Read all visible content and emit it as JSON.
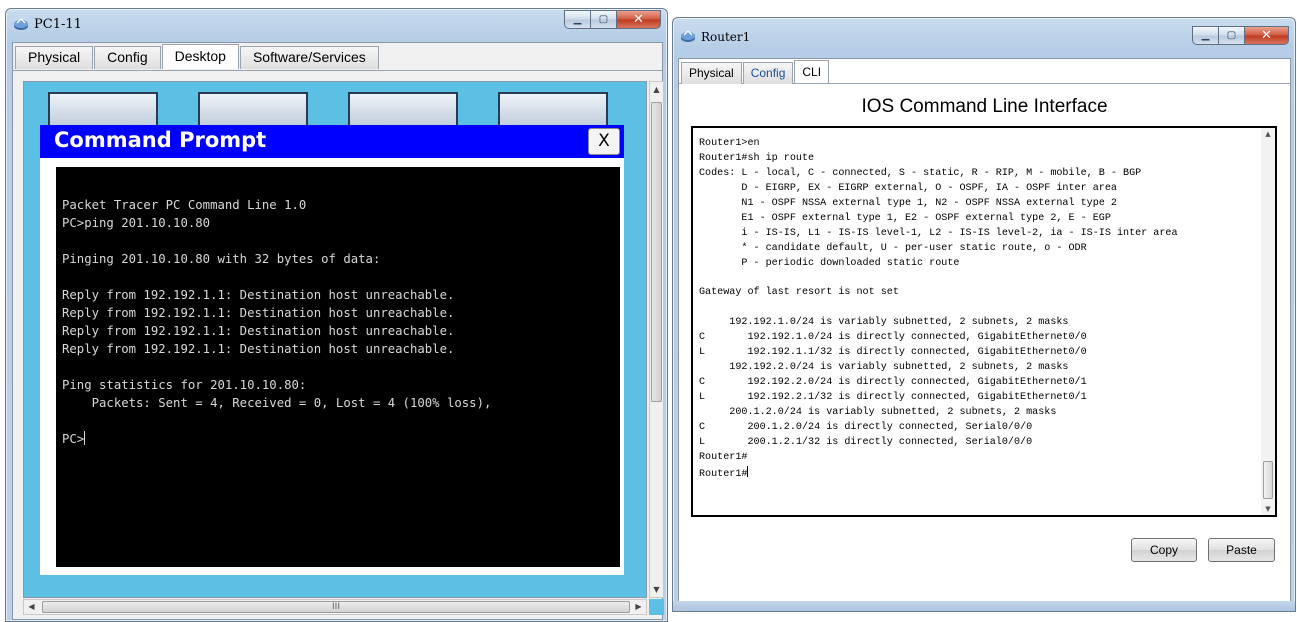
{
  "pc_window": {
    "title": "PC1-11",
    "tabs": [
      "Physical",
      "Config",
      "Desktop",
      "Software/Services"
    ],
    "active_tab": "Desktop",
    "command_prompt": {
      "title": "Command Prompt",
      "close_label": "X",
      "lines": [
        "Packet Tracer PC Command Line 1.0",
        "PC>ping 201.10.10.80",
        "",
        "Pinging 201.10.10.80 with 32 bytes of data:",
        "",
        "Reply from 192.192.1.1: Destination host unreachable.",
        "Reply from 192.192.1.1: Destination host unreachable.",
        "Reply from 192.192.1.1: Destination host unreachable.",
        "Reply from 192.192.1.1: Destination host unreachable.",
        "",
        "Ping statistics for 201.10.10.80:",
        "    Packets: Sent = 4, Received = 0, Lost = 4 (100% loss),",
        "",
        "PC>"
      ]
    },
    "hscroll_grip": "III"
  },
  "router_window": {
    "title": "Router1",
    "tabs": [
      "Physical",
      "Config",
      "CLI"
    ],
    "active_tab": "CLI",
    "heading": "IOS Command Line Interface",
    "cli_lines": [
      "Router1>en",
      "Router1#sh ip route",
      "Codes: L - local, C - connected, S - static, R - RIP, M - mobile, B - BGP",
      "       D - EIGRP, EX - EIGRP external, O - OSPF, IA - OSPF inter area",
      "       N1 - OSPF NSSA external type 1, N2 - OSPF NSSA external type 2",
      "       E1 - OSPF external type 1, E2 - OSPF external type 2, E - EGP",
      "       i - IS-IS, L1 - IS-IS level-1, L2 - IS-IS level-2, ia - IS-IS inter area",
      "       * - candidate default, U - per-user static route, o - ODR",
      "       P - periodic downloaded static route",
      "",
      "Gateway of last resort is not set",
      "",
      "     192.192.1.0/24 is variably subnetted, 2 subnets, 2 masks",
      "C       192.192.1.0/24 is directly connected, GigabitEthernet0/0",
      "L       192.192.1.1/32 is directly connected, GigabitEthernet0/0",
      "     192.192.2.0/24 is variably subnetted, 2 subnets, 2 masks",
      "C       192.192.2.0/24 is directly connected, GigabitEthernet0/1",
      "L       192.192.2.1/32 is directly connected, GigabitEthernet0/1",
      "     200.1.2.0/24 is variably subnetted, 2 subnets, 2 masks",
      "C       200.1.2.0/24 is directly connected, Serial0/0/0",
      "L       200.1.2.1/32 is directly connected, Serial0/0/0",
      "Router1#",
      "Router1#"
    ],
    "copy_label": "Copy",
    "paste_label": "Paste"
  },
  "icons": [
    "router-icon",
    "minimize-icon",
    "maximize-icon",
    "close-icon"
  ]
}
